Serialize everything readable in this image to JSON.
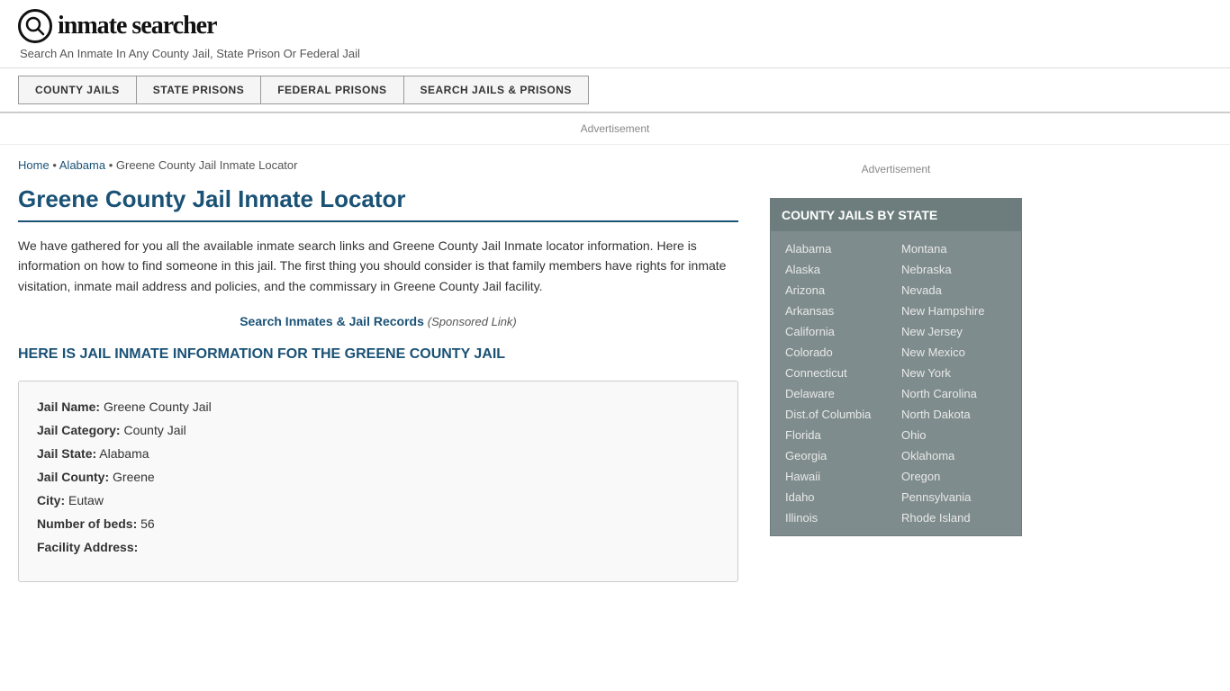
{
  "header": {
    "logo_letter": "i",
    "logo_text": "inmate searcher",
    "tagline": "Search An Inmate In Any County Jail, State Prison Or Federal Jail"
  },
  "nav": {
    "items": [
      {
        "label": "COUNTY JAILS",
        "id": "county-jails"
      },
      {
        "label": "STATE PRISONS",
        "id": "state-prisons"
      },
      {
        "label": "FEDERAL PRISONS",
        "id": "federal-prisons"
      },
      {
        "label": "SEARCH JAILS & PRISONS",
        "id": "search-jails"
      }
    ]
  },
  "ad": {
    "label": "Advertisement"
  },
  "breadcrumb": {
    "home": "Home",
    "state": "Alabama",
    "current": "Greene County Jail Inmate Locator"
  },
  "page": {
    "title": "Greene County Jail Inmate Locator",
    "description": "We have gathered for you all the available inmate search links and Greene County Jail Inmate locator information. Here is information on how to find someone in this jail. The first thing you should consider is that family members have rights for inmate visitation, inmate mail address and policies, and the commissary in Greene County Jail facility.",
    "search_link_text": "Search Inmates & Jail Records",
    "search_link_suffix": "(Sponsored Link)",
    "section_header": "HERE IS JAIL INMATE INFORMATION FOR THE GREENE COUNTY JAIL"
  },
  "jail_info": {
    "fields": [
      {
        "label": "Jail Name:",
        "value": "Greene County Jail"
      },
      {
        "label": "Jail Category:",
        "value": "County Jail"
      },
      {
        "label": "Jail State:",
        "value": "Alabama"
      },
      {
        "label": "Jail County:",
        "value": "Greene"
      },
      {
        "label": "City:",
        "value": "Eutaw"
      },
      {
        "label": "Number of beds:",
        "value": "56"
      },
      {
        "label": "Facility Address:",
        "value": ""
      }
    ]
  },
  "sidebar": {
    "ad_label": "Advertisement",
    "state_box_title": "COUNTY JAILS BY STATE",
    "states_col1": [
      "Alabama",
      "Alaska",
      "Arizona",
      "Arkansas",
      "California",
      "Colorado",
      "Connecticut",
      "Delaware",
      "Dist.of Columbia",
      "Florida",
      "Georgia",
      "Hawaii",
      "Idaho",
      "Illinois"
    ],
    "states_col2": [
      "Montana",
      "Nebraska",
      "Nevada",
      "New Hampshire",
      "New Jersey",
      "New Mexico",
      "New York",
      "North Carolina",
      "North Dakota",
      "Ohio",
      "Oklahoma",
      "Oregon",
      "Pennsylvania",
      "Rhode Island"
    ]
  }
}
